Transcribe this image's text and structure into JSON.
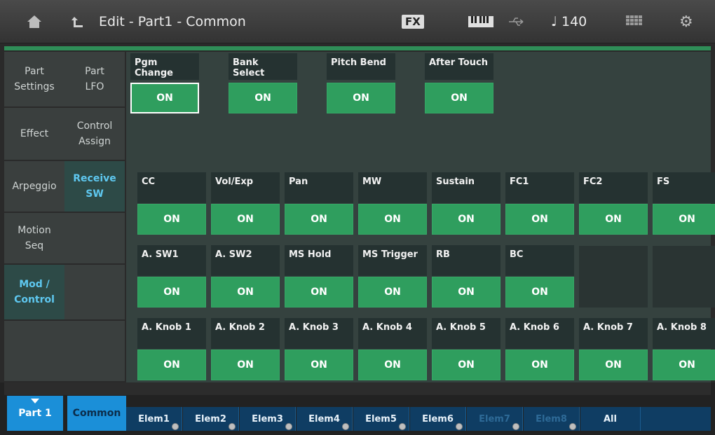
{
  "header": {
    "title": "Edit - Part1 - Common",
    "fx": "FX",
    "tempo": "♩ 140"
  },
  "sidebar_col1": [
    {
      "label": "Part\nSettings"
    },
    {
      "label": "Effect"
    },
    {
      "label": "Arpeggio"
    },
    {
      "label": "Motion\nSeq"
    },
    {
      "label": "Mod /\nControl"
    },
    {
      "label": ""
    }
  ],
  "sidebar_col2": [
    {
      "label": "Part\nLFO"
    },
    {
      "label": "Control\nAssign"
    },
    {
      "label": "Receive\nSW"
    },
    {
      "label": ""
    },
    {
      "label": ""
    },
    {
      "label": ""
    }
  ],
  "row0": [
    {
      "label": "Pgm Change",
      "value": "ON"
    },
    {
      "label": "Bank Select",
      "value": "ON"
    },
    {
      "label": "Pitch Bend",
      "value": "ON"
    },
    {
      "label": "After Touch",
      "value": "ON"
    }
  ],
  "row1": [
    {
      "label": "CC",
      "value": "ON"
    },
    {
      "label": "Vol/Exp",
      "value": "ON"
    },
    {
      "label": "Pan",
      "value": "ON"
    },
    {
      "label": "MW",
      "value": "ON"
    },
    {
      "label": "Sustain",
      "value": "ON"
    },
    {
      "label": "FC1",
      "value": "ON"
    },
    {
      "label": "FC2",
      "value": "ON"
    },
    {
      "label": "FS",
      "value": "ON"
    }
  ],
  "row2": [
    {
      "label": "A. SW1",
      "value": "ON"
    },
    {
      "label": "A. SW2",
      "value": "ON"
    },
    {
      "label": "MS Hold",
      "value": "ON"
    },
    {
      "label": "MS Trigger",
      "value": "ON"
    },
    {
      "label": "RB",
      "value": "ON"
    },
    {
      "label": "BC",
      "value": "ON"
    }
  ],
  "row3": [
    {
      "label": "A. Knob 1",
      "value": "ON"
    },
    {
      "label": "A. Knob 2",
      "value": "ON"
    },
    {
      "label": "A. Knob 3",
      "value": "ON"
    },
    {
      "label": "A. Knob 4",
      "value": "ON"
    },
    {
      "label": "A. Knob 5",
      "value": "ON"
    },
    {
      "label": "A. Knob 6",
      "value": "ON"
    },
    {
      "label": "A. Knob 7",
      "value": "ON"
    },
    {
      "label": "A. Knob 8",
      "value": "ON"
    }
  ],
  "bottom": {
    "part": "Part 1",
    "common": "Common",
    "elements": [
      "Elem1",
      "Elem2",
      "Elem3",
      "Elem4",
      "Elem5",
      "Elem6",
      "Elem7",
      "Elem8"
    ],
    "all": "All"
  },
  "icons": {
    "home": "home-icon",
    "back": "back-arrow-icon",
    "keyboard": "keyboard-icon",
    "usb": "usb-icon",
    "grid": "grid-icon",
    "gear": "gear-icon"
  },
  "colors": {
    "accent_green": "#2f9e5e",
    "tab_blue": "#1b8fd8",
    "active_text": "#5ec8f0"
  }
}
